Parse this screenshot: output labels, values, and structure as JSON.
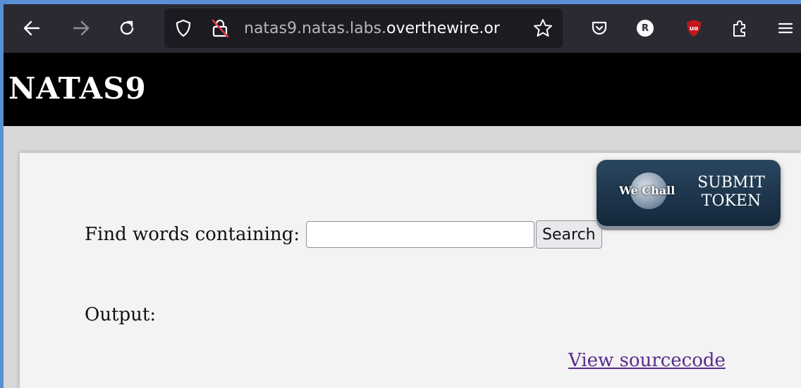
{
  "browser": {
    "url_prefix": "natas9.natas.labs.",
    "url_domain": "overthewire.or",
    "profile_initial": "R",
    "icons": {
      "back": "arrow-left-icon",
      "forward": "arrow-right-icon",
      "reload": "reload-icon",
      "shield": "shield-icon",
      "lock": "lock-warning-icon",
      "bookmark": "star-icon",
      "pocket": "pocket-icon",
      "ublock": "ublock-icon",
      "extensions": "extensions-icon",
      "menu": "hamburger-menu-icon"
    },
    "colors": {
      "toolbar": "#2b2a33",
      "urlbar": "#1c1b22",
      "ublock": "#c4161c"
    }
  },
  "header": {
    "title": "NATAS9"
  },
  "wechall": {
    "name": "We Chall",
    "submit_line1": "SUBMIT",
    "submit_line2": "TOKEN"
  },
  "form": {
    "label": "Find words containing:",
    "input_value": "",
    "button_label": "Search"
  },
  "output": {
    "label": "Output:"
  },
  "footer": {
    "source_link": "View sourcecode",
    "link_color": "#5a2a8f"
  }
}
